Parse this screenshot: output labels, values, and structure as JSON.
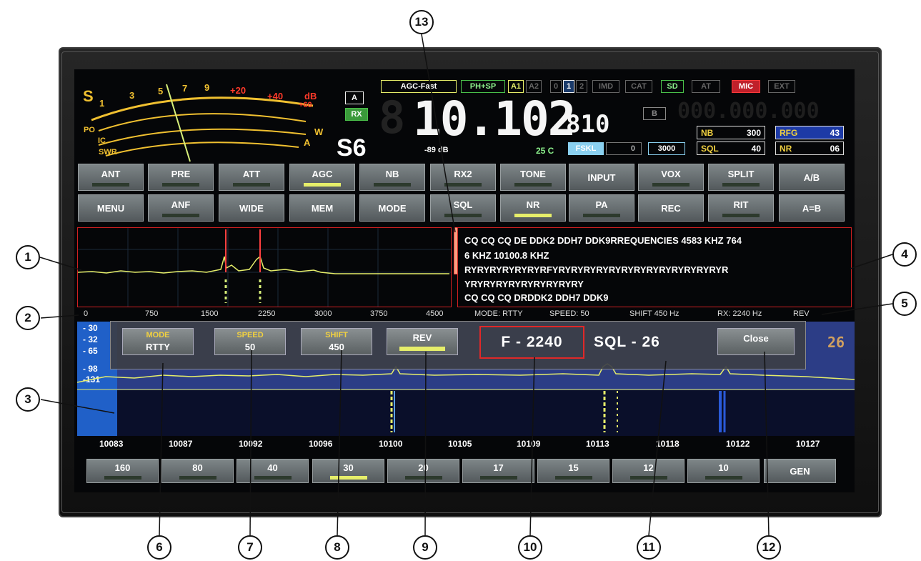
{
  "meter": {
    "s_label": "S",
    "s_scale": [
      "1",
      "3",
      "5",
      "7",
      "9"
    ],
    "plus_scale": [
      "+20",
      "+40"
    ],
    "db_label": "dB",
    "db_plus60": "+60",
    "po_label": "PO",
    "ic_label": "IC",
    "swr_label": "SWR",
    "w_label": "W",
    "a_label": "A",
    "s_reading": "S6",
    "db_reading": "-89 dB"
  },
  "top": {
    "vfo_a": "A",
    "rx": "RX",
    "agc": "AGC-Fast",
    "phsp": "PH+SP",
    "a1": "A1",
    "a2": "A2",
    "n0": "0",
    "n1": "1",
    "n2": "2",
    "imd": "IMD",
    "cat": "CAT",
    "sd": "SD",
    "at": "AT",
    "mic": "MIC",
    "ext": "EXT",
    "vfo_b": "B",
    "freq_main": "10.102",
    "freq_sub": "810",
    "ghost_b": "000.000.000",
    "temp": "25 C",
    "fskl": "FSKL",
    "zero": "0",
    "bw": "3000",
    "nb_label": "NB",
    "nb_value": "300",
    "sql_label": "SQL",
    "sql_value": "40",
    "rfg_label": "RFG",
    "rfg_value": "43",
    "nr_label": "NR",
    "nr_value": "06"
  },
  "buttons_row1": [
    {
      "label": "ANT",
      "led": "off"
    },
    {
      "label": "PRE",
      "led": "off"
    },
    {
      "label": "ATT",
      "led": "off"
    },
    {
      "label": "AGC",
      "led": "on"
    },
    {
      "label": "NB",
      "led": "off"
    },
    {
      "label": "RX2",
      "led": "off"
    },
    {
      "label": "TONE",
      "led": "off"
    },
    {
      "label": "INPUT",
      "led": "none"
    },
    {
      "label": "VOX",
      "led": "off"
    },
    {
      "label": "SPLIT",
      "led": "off"
    },
    {
      "label": "A/B",
      "led": "none"
    }
  ],
  "buttons_row2": [
    {
      "label": "MENU",
      "led": "none"
    },
    {
      "label": "ANF",
      "led": "off"
    },
    {
      "label": "WIDE",
      "led": "none"
    },
    {
      "label": "MEM",
      "led": "none"
    },
    {
      "label": "MODE",
      "led": "none"
    },
    {
      "label": "SQL",
      "led": "off"
    },
    {
      "label": "NR",
      "led": "on"
    },
    {
      "label": "PA",
      "led": "off"
    },
    {
      "label": "REC",
      "led": "none"
    },
    {
      "label": "RIT",
      "led": "off"
    },
    {
      "label": "A=B",
      "led": "none"
    }
  ],
  "decoder": {
    "lines": [
      "CQ CQ CQ DE DDK2 DDH7 DDK9RREQUENCIES  4583 KHZ  764",
      "6 KHZ  10100.8 KHZ",
      "RYRYRYRYRYRYRFYRYRYRYRYRYRYRYRYRYRYRYRYRYR",
      "YRYRYRYRYRYRYRYRYRY",
      "CQ CQ CQ DRDDK2 DDH7 DDK9"
    ]
  },
  "scale": {
    "ticks": [
      "0",
      "750",
      "1500",
      "2250",
      "3000",
      "3750",
      "4500"
    ],
    "mode": "MODE: RTTY",
    "speed": "SPEED: 50",
    "shift": "SHIFT 450 Hz",
    "rx": "RX: 2240 Hz",
    "rev": "REV"
  },
  "waterfall": {
    "db_levels": [
      "- 30",
      "- 32",
      "- 65",
      "- 98",
      "-131"
    ],
    "right_digits": "26"
  },
  "dialog": {
    "mode_title": "MODE",
    "mode_value": "RTTY",
    "speed_title": "SPEED",
    "speed_value": "50",
    "shift_title": "SHIFT",
    "shift_value": "450",
    "rev_label": "REV",
    "f_readout": "F - 2240",
    "sql_readout": "SQL - 26",
    "close_label": "Close"
  },
  "freq_scale": [
    "10083",
    "10087",
    "10092",
    "10096",
    "10100",
    "10105",
    "10109",
    "10113",
    "10118",
    "10122",
    "10127"
  ],
  "bands": [
    {
      "label": "160",
      "led": "off"
    },
    {
      "label": "80",
      "led": "off"
    },
    {
      "label": "40",
      "led": "off"
    },
    {
      "label": "30",
      "led": "on"
    },
    {
      "label": "20",
      "led": "off"
    },
    {
      "label": "17",
      "led": "off"
    },
    {
      "label": "15",
      "led": "off"
    },
    {
      "label": "12",
      "led": "off"
    },
    {
      "label": "10",
      "led": "off"
    },
    {
      "label": "GEN",
      "led": "none"
    }
  ],
  "callouts": [
    "1",
    "2",
    "3",
    "4",
    "5",
    "6",
    "7",
    "8",
    "9",
    "10",
    "11",
    "12",
    "13"
  ],
  "colors": {
    "accent_yellow": "#e6ee6a",
    "panel_red": "#d02020",
    "meter_amber": "#f0c030"
  }
}
